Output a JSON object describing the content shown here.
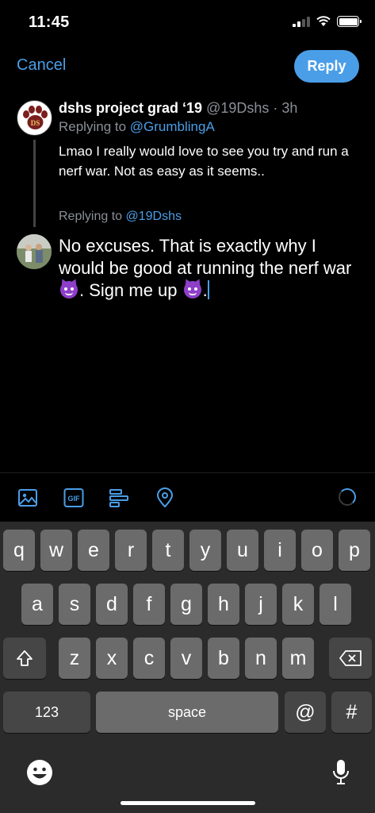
{
  "status": {
    "time": "11:45"
  },
  "nav": {
    "cancel": "Cancel",
    "reply": "Reply"
  },
  "original": {
    "name": "dshs project grad ‘19",
    "handle": "@19Dshs",
    "sep": " · ",
    "age": "3h",
    "replying_prefix": "Replying to ",
    "replying_handle": "@GrumblingA",
    "text": "Lmao I really would love to see you try and run a nerf war. Not as easy as it seems.."
  },
  "compose": {
    "replying_prefix": "Replying to ",
    "replying_handle": "@19Dshs",
    "text_part1": "No excuses. That is exactly why I would be good at running the nerf war ",
    "text_part2": ". Sign me up ",
    "text_part3": "."
  },
  "toolbar": [
    "image-icon",
    "gif-icon",
    "poll-icon",
    "location-icon"
  ],
  "gif_label": "GIF",
  "keyboard": {
    "row1": [
      "q",
      "w",
      "e",
      "r",
      "t",
      "y",
      "u",
      "i",
      "o",
      "p"
    ],
    "row2": [
      "a",
      "s",
      "d",
      "f",
      "g",
      "h",
      "j",
      "k",
      "l"
    ],
    "row3": [
      "z",
      "x",
      "c",
      "v",
      "b",
      "n",
      "m"
    ],
    "numbers": "123",
    "space": "space",
    "at": "@",
    "hash": "#"
  },
  "colors": {
    "accent": "#4a9ee8",
    "muted": "#8b8f96",
    "background": "#000000"
  }
}
